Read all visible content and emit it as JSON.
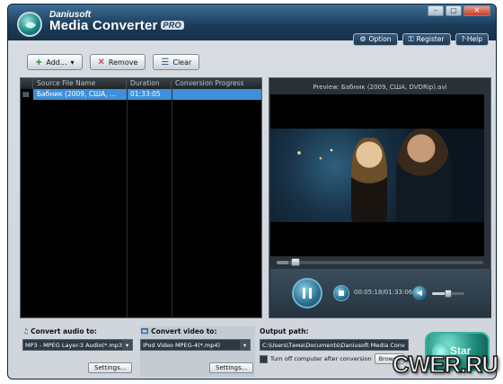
{
  "app": {
    "brand_small": "Daniusoft",
    "brand_name": "Media Converter",
    "badge": "PRO"
  },
  "window_controls": {
    "minimize": "–",
    "maximize": "□",
    "close": "✕"
  },
  "top_buttons": {
    "option": "Option",
    "register": "Register",
    "help": "?·Help"
  },
  "toolbar": {
    "add": "Add...",
    "remove": "Remove",
    "clear": "Clear"
  },
  "file_list": {
    "columns": [
      "Source File Name",
      "Duration",
      "Conversion Progress"
    ],
    "rows": [
      {
        "name": "Бабник (2009, США, ...",
        "duration": "01:33:05",
        "progress": ""
      }
    ]
  },
  "preview": {
    "title": "Preview: Бабник (2009, США, DVDRip).avi",
    "time": "00:05:18/01:33:06",
    "seek_fraction": 0.057,
    "volume_fraction": 0.5
  },
  "bottom": {
    "audio_label": "Convert audio to:",
    "audio_value": "MP3 - MPEG Layer-3 Audio(*.mp3",
    "audio_settings": "Settings...",
    "video_label": "Convert video to:",
    "video_value": "iPod Video MPEG-4(*.mp4)",
    "video_settings": "Settings...",
    "output_label": "Output path:",
    "output_value": "C:\\Users\\Тема\\Documents\\Daniusoft Media Conv",
    "turn_off_label": "Turn off computer after conversion",
    "browse": "Browse",
    "start": "Star"
  },
  "watermark": "CWER.RU",
  "colors": {
    "accent": "#3f8fd9",
    "title_bar": "#1b3a57",
    "start_button": "#1f8e80"
  }
}
